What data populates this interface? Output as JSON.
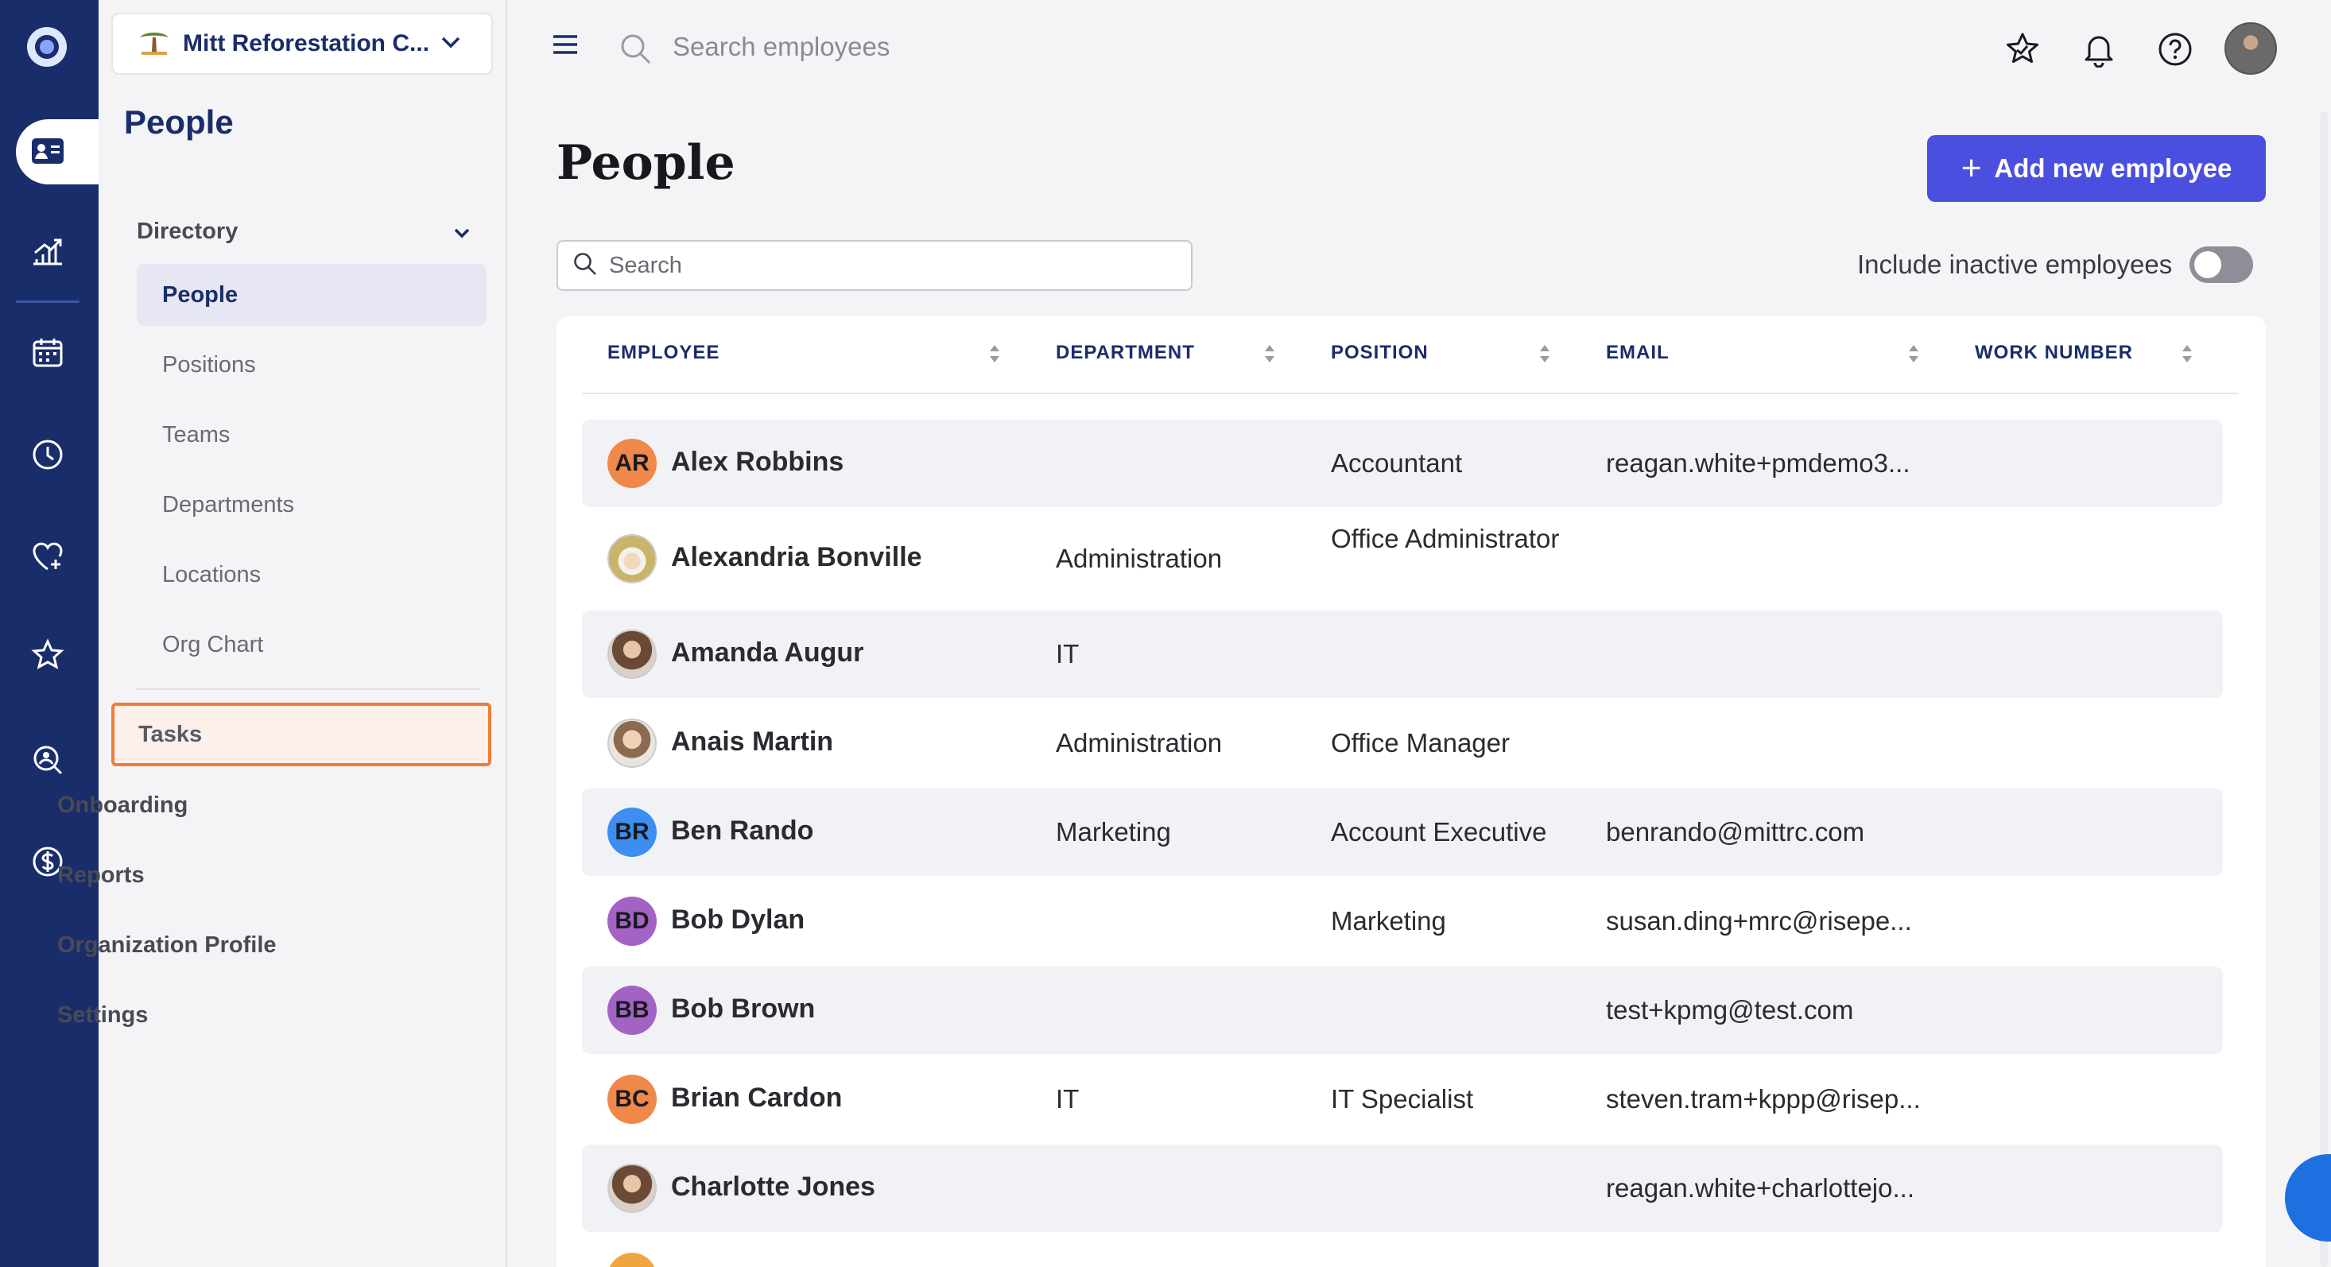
{
  "org": {
    "name": "Mitt Reforestation C..."
  },
  "sidebar": {
    "title": "People",
    "directory_label": "Directory",
    "directory_items": [
      "People",
      "Positions",
      "Teams",
      "Departments",
      "Locations",
      "Org Chart"
    ],
    "sections": [
      "Tasks",
      "Onboarding",
      "Reports",
      "Organization Profile",
      "Settings"
    ]
  },
  "topbar": {
    "search_placeholder": "Search employees"
  },
  "main": {
    "title": "People",
    "add_button": "Add new employee",
    "search_placeholder": "Search",
    "inactive_toggle_label": "Include inactive employees",
    "inactive_toggle_on": false
  },
  "table": {
    "columns": [
      "EMPLOYEE",
      "DEPARTMENT",
      "POSITION",
      "EMAIL",
      "WORK NUMBER"
    ],
    "rows": [
      {
        "initials": "AR",
        "avatar_color": "#f0884a",
        "name": "Alex Robbins",
        "department": "",
        "position": "Accountant",
        "email": "reagan.white+pmdemo3...",
        "work_number": ""
      },
      {
        "initials": "",
        "avatar_color": "photo-hat",
        "name": "Alexandria Bonville",
        "department": "Administration",
        "position": "Office Administrator",
        "email": "",
        "work_number": ""
      },
      {
        "initials": "",
        "avatar_color": "photo",
        "name": "Amanda Augur",
        "department": "IT",
        "position": "",
        "email": "",
        "work_number": ""
      },
      {
        "initials": "",
        "avatar_color": "photo-light",
        "name": "Anais Martin",
        "department": "Administration",
        "position": "Office Manager",
        "email": "",
        "work_number": ""
      },
      {
        "initials": "BR",
        "avatar_color": "#3d8ef0",
        "name": "Ben Rando",
        "department": "Marketing",
        "position": "Account Executive",
        "email": "benrando@mittrc.com",
        "work_number": ""
      },
      {
        "initials": "BD",
        "avatar_color": "#a363c4",
        "name": "Bob Dylan",
        "department": "",
        "position": "Marketing",
        "email": "susan.ding+mrc@risepe...",
        "work_number": ""
      },
      {
        "initials": "BB",
        "avatar_color": "#a363c4",
        "name": "Bob Brown",
        "department": "",
        "position": "",
        "email": "test+kpmg@test.com",
        "work_number": ""
      },
      {
        "initials": "BC",
        "avatar_color": "#f0884a",
        "name": "Brian Cardon",
        "department": "IT",
        "position": "IT Specialist",
        "email": "steven.tram+kppp@risep...",
        "work_number": ""
      },
      {
        "initials": "",
        "avatar_color": "photo",
        "name": "Charlotte Jones",
        "department": "",
        "position": "",
        "email": "reagan.white+charlottejo...",
        "work_number": ""
      }
    ]
  },
  "colors": {
    "rail": "#1a2d6b",
    "accent": "#4b4fe0",
    "highlight": "#f07c38"
  }
}
